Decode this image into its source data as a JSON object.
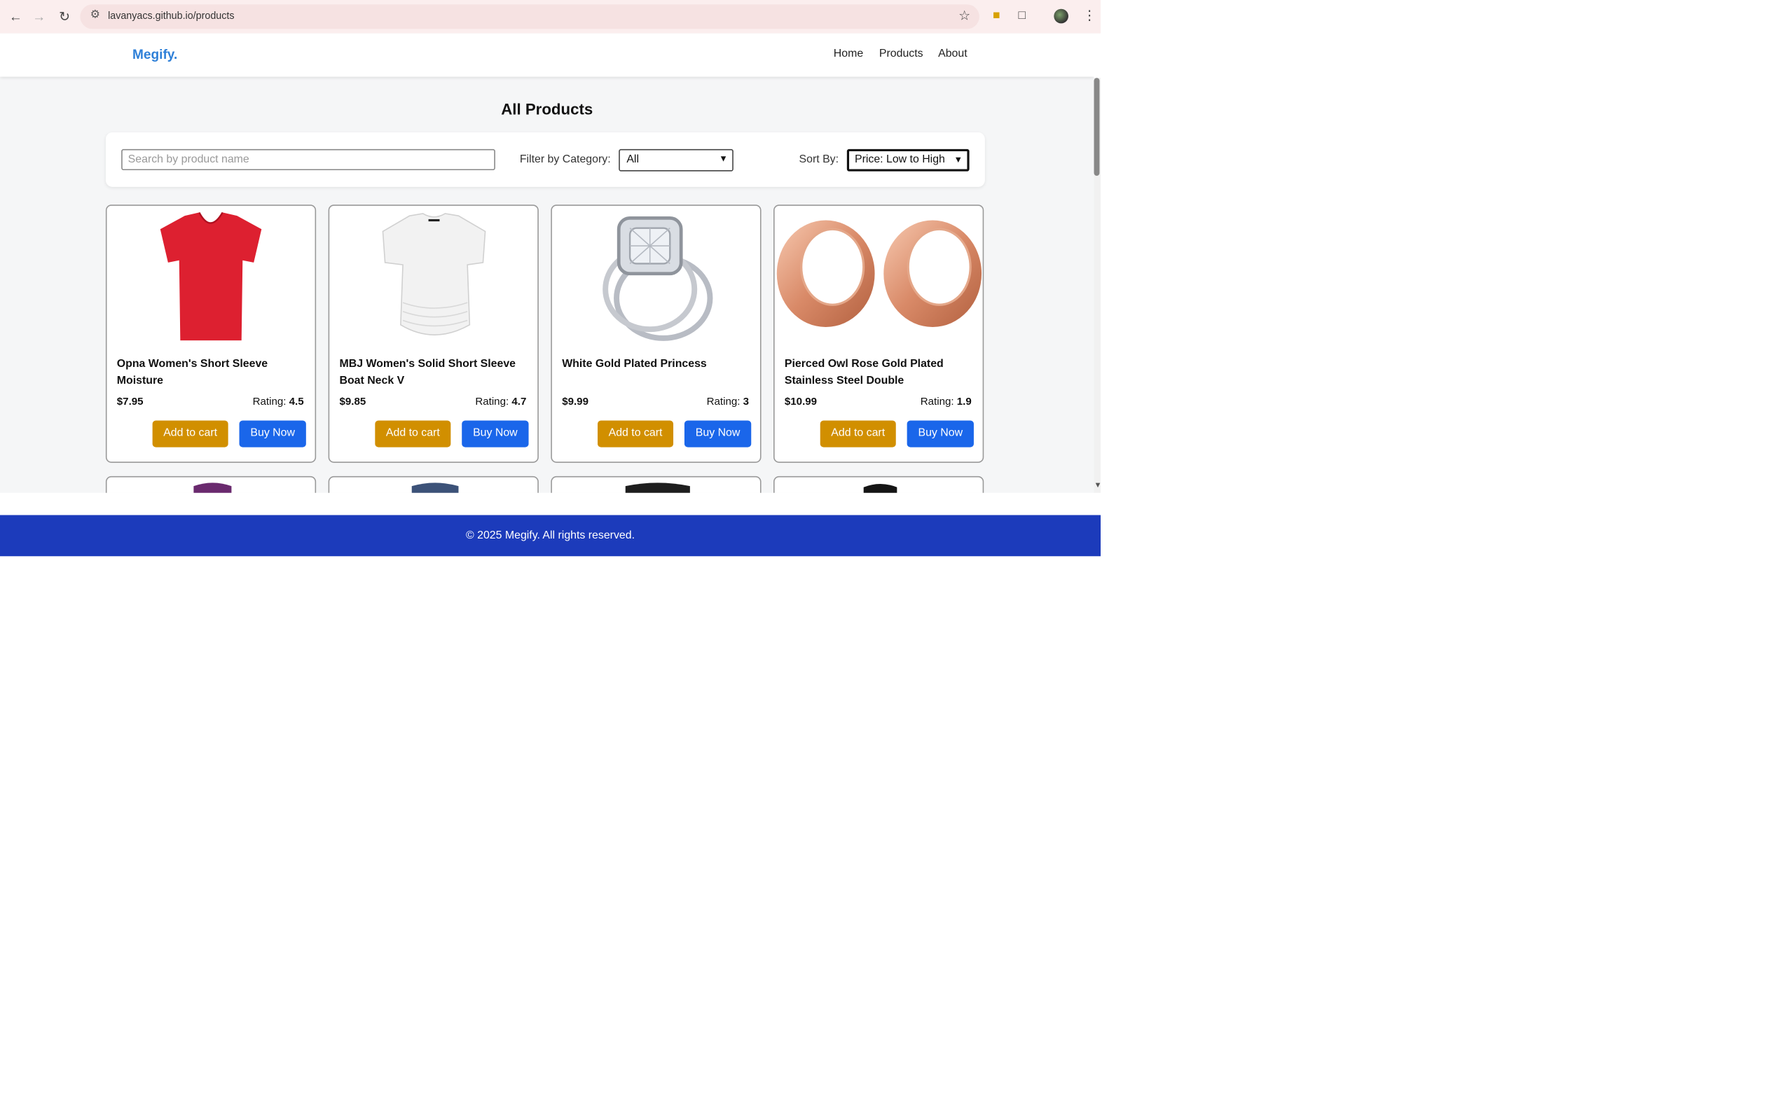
{
  "browser": {
    "url": "lavanyacs.github.io/products"
  },
  "nav": {
    "brand": "Megify.",
    "links": [
      "Home",
      "Products",
      "About"
    ]
  },
  "page": {
    "heading": "All Products"
  },
  "filters": {
    "search_placeholder": "Search by product name",
    "category_label": "Filter by Category:",
    "category_value": "All",
    "sort_label": "Sort By:",
    "sort_value": "Price: Low to High"
  },
  "products": [
    {
      "title": "Opna Women's Short Sleeve Moisture",
      "price": "$7.95",
      "rating_label": "Rating:",
      "rating": "4.5",
      "cart_label": "Add to cart",
      "buy_label": "Buy Now",
      "image": "red-tshirt"
    },
    {
      "title": "MBJ Women's Solid Short Sleeve Boat Neck V",
      "price": "$9.85",
      "rating_label": "Rating:",
      "rating": "4.7",
      "cart_label": "Add to cart",
      "buy_label": "Buy Now",
      "image": "white-top"
    },
    {
      "title": "White Gold Plated Princess",
      "price": "$9.99",
      "rating_label": "Rating:",
      "rating": "3",
      "cart_label": "Add to cart",
      "buy_label": "Buy Now",
      "image": "diamond-ring"
    },
    {
      "title": "Pierced Owl Rose Gold Plated Stainless Steel Double",
      "price": "$10.99",
      "rating_label": "Rating:",
      "rating": "1.9",
      "cart_label": "Add to cart",
      "buy_label": "Buy Now",
      "image": "rose-gold-plugs"
    }
  ],
  "footer": {
    "text": "© 2025 Megify. All rights reserved."
  },
  "colors": {
    "brand": "#2f80d8",
    "add_to_cart": "#d18f00",
    "buy_now": "#1a66ea",
    "footer": "#1c3bbb"
  }
}
